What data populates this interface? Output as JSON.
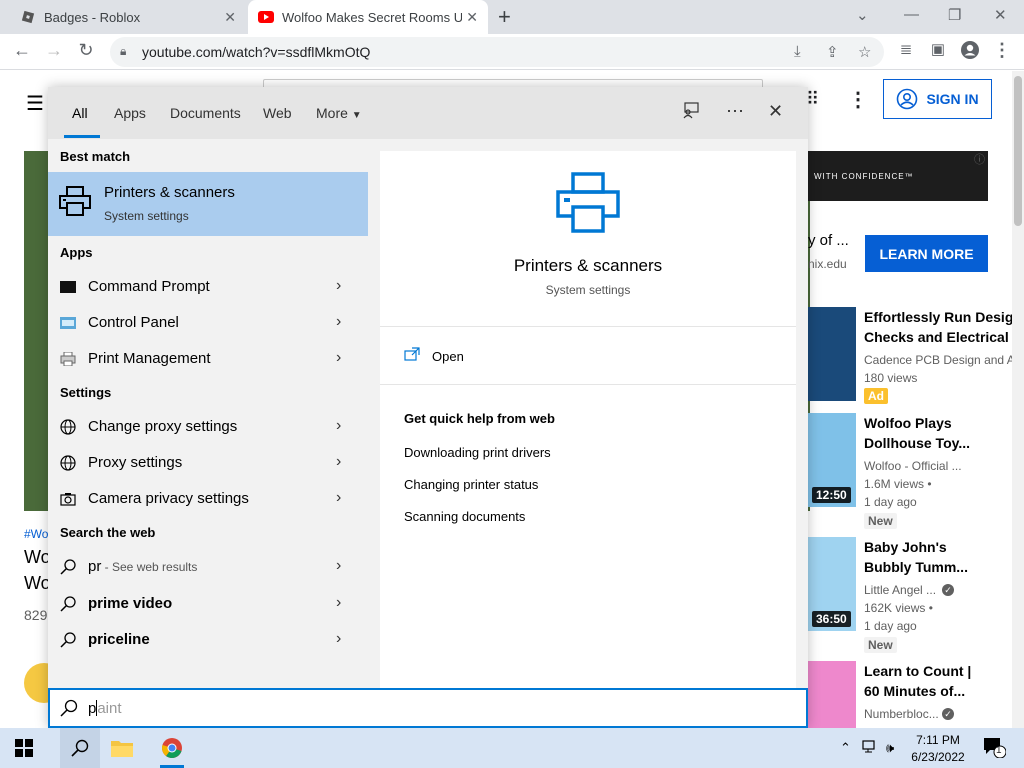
{
  "browser": {
    "tabs": [
      {
        "title": "Badges - Roblox",
        "icon": "roblox-icon"
      },
      {
        "title": "Wolfoo Makes Secret Rooms Un",
        "icon": "youtube-icon"
      }
    ],
    "new_tab": "+",
    "url": "youtube.com/watch?v=ssdflMkmOtQ"
  },
  "youtube": {
    "sign_in": "SIGN IN",
    "ad_banner_text": "WITH CONFIDENCE™",
    "ad_title": "y of ...",
    "ad_domain": "nix.edu",
    "learn_more": "LEARN MORE",
    "left_hashtag": "#Wo",
    "left_title_1": "Wo",
    "left_title_2": "Wo",
    "left_views": "829",
    "recommendations": [
      {
        "title1": "Effortlessly Run Design",
        "title2": "Checks and Electrical S",
        "channel": "Cadence PCB Design and A",
        "views": "180 views",
        "age": "",
        "badge": "Ad",
        "duration": ""
      },
      {
        "title1": "Wolfoo Plays",
        "title2": "Dollhouse Toy...",
        "channel": "Wolfoo - Official ...",
        "views": "1.6M views •",
        "age": "1 day ago",
        "badge": "New",
        "duration": "12:50"
      },
      {
        "title1": "Baby John's",
        "title2": "Bubbly Tumm...",
        "channel": "Little Angel ...",
        "views": "162K views •",
        "age": "1 day ago",
        "badge": "New",
        "duration": "36:50"
      },
      {
        "title1": "Learn to Count |",
        "title2": "60 Minutes of...",
        "channel": "Numberbloc...",
        "views": "",
        "age": "",
        "badge": "",
        "duration": ""
      }
    ]
  },
  "search_panel": {
    "tabs": [
      "All",
      "Apps",
      "Documents",
      "Web",
      "More"
    ],
    "best_match_header": "Best match",
    "best_match": {
      "title": "Printers & scanners",
      "subtitle": "System settings"
    },
    "apps_header": "Apps",
    "apps": [
      {
        "label": "Command Prompt",
        "bold": "P",
        "icon": "cmd-icon"
      },
      {
        "label": "Control Panel",
        "icon": "control-panel-icon"
      },
      {
        "label": "Print Management",
        "icon": "print-management-icon"
      }
    ],
    "settings_header": "Settings",
    "settings": [
      {
        "label": "Change proxy settings",
        "icon": "globe-icon"
      },
      {
        "label": "Proxy settings",
        "icon": "globe-icon"
      },
      {
        "label": "Camera privacy settings",
        "icon": "camera-icon"
      }
    ],
    "web_header": "Search the web",
    "web": [
      {
        "label": "pr",
        "suffix": " - See web results"
      },
      {
        "label": "prime video",
        "suffix": ""
      },
      {
        "label": "priceline",
        "suffix": ""
      }
    ],
    "detail": {
      "title": "Printers & scanners",
      "subtitle": "System settings",
      "open": "Open",
      "quick_help_header": "Get quick help from web",
      "quick_help": [
        "Downloading print drivers",
        "Changing printer status",
        "Scanning documents"
      ]
    },
    "search_box": {
      "typed": "p",
      "suggestion": "aint"
    }
  },
  "taskbar": {
    "time": "7:11 PM",
    "date": "6/23/2022",
    "notification_count": "1"
  },
  "colors": {
    "accent": "#0078d4",
    "best_match_bg": "#aaccee",
    "youtube_blue": "#065fd4",
    "taskbar_bg": "#d7e4f4"
  }
}
